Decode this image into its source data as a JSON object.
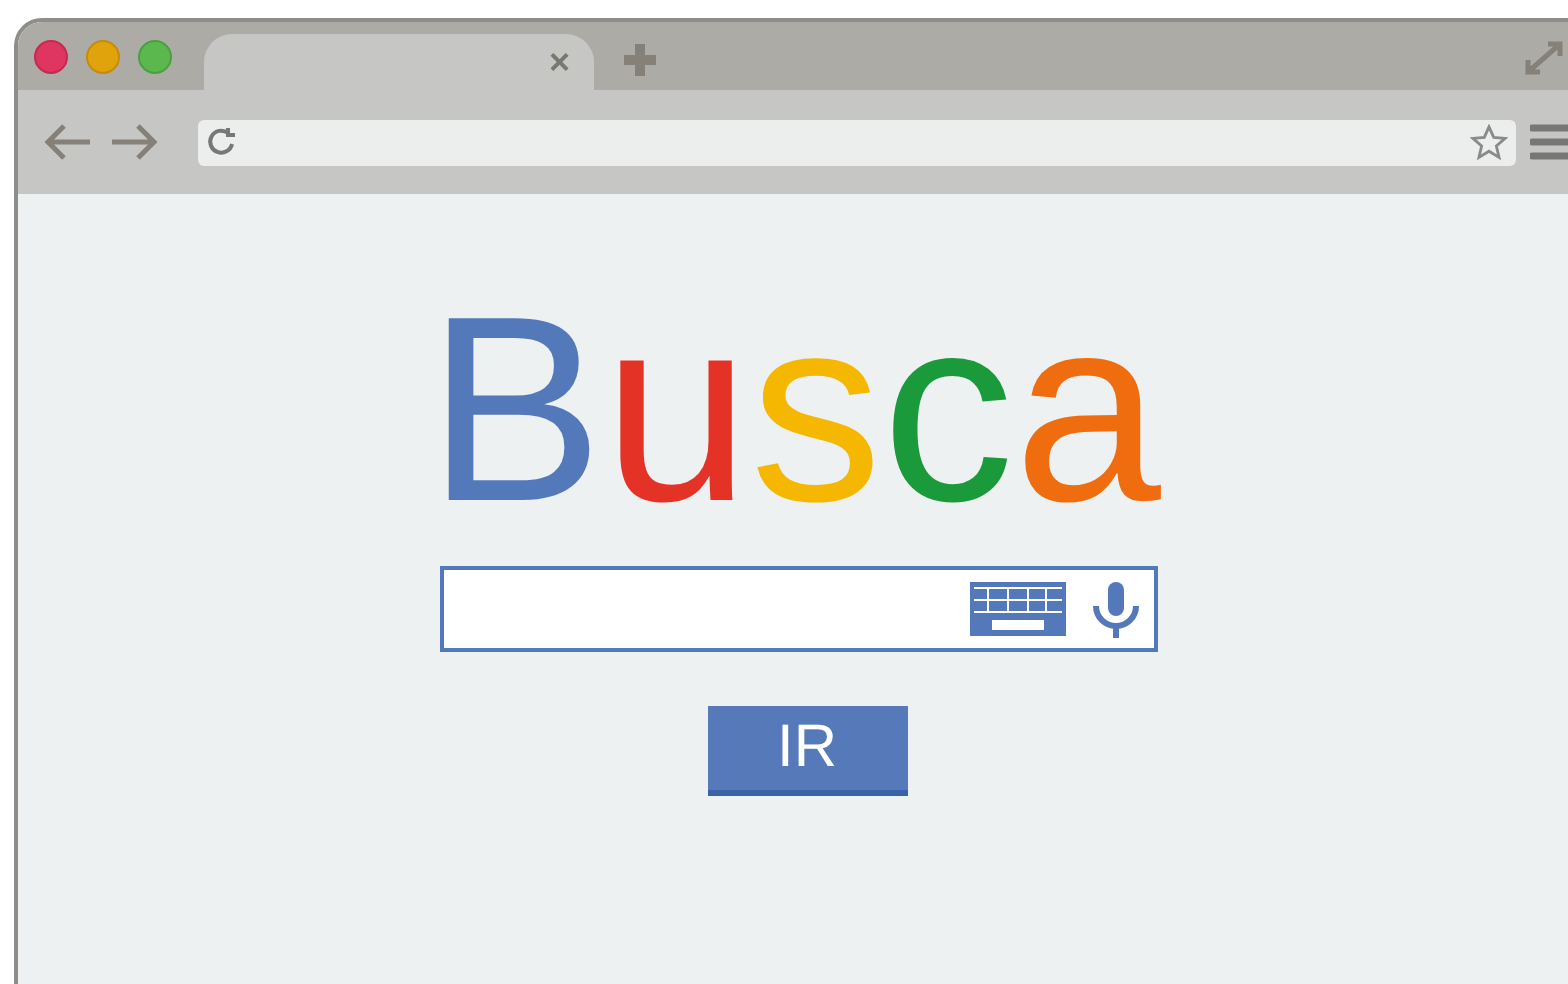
{
  "logo": {
    "letters": [
      {
        "text": "B",
        "color": "#5479bb"
      },
      {
        "text": "u",
        "color": "#e53227"
      },
      {
        "text": "s",
        "color": "#f6b700"
      },
      {
        "text": "c",
        "color": "#1b9a3b"
      },
      {
        "text": "a",
        "color": "#ef6c0f"
      }
    ]
  },
  "tab": {
    "close": "×"
  },
  "search_button": {
    "label": "IR"
  }
}
